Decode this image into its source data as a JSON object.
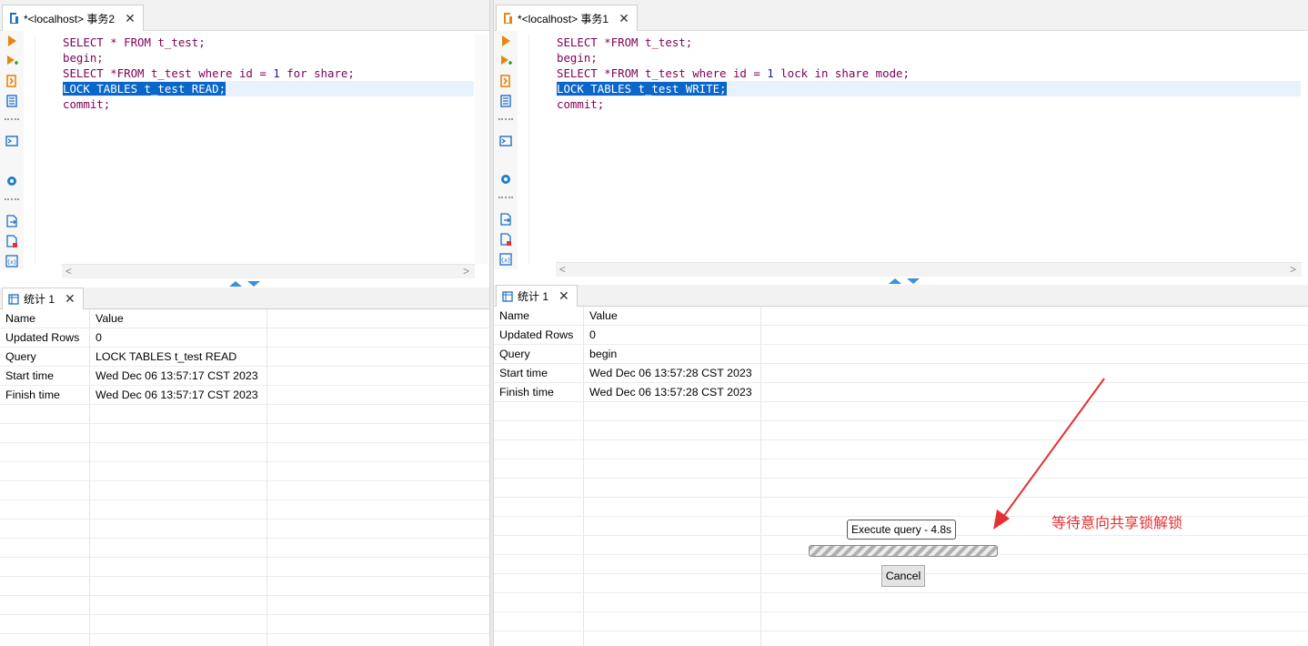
{
  "left": {
    "tab_title": "*<localhost> 事务2",
    "close_glyph": "✕",
    "code": [
      [
        {
          "t": "SELECT * FROM t_test",
          "c": "kw"
        },
        {
          "t": ";",
          "c": "kw"
        }
      ],
      [
        {
          "t": "begin;",
          "c": "kw"
        }
      ],
      [
        {
          "t": "SELECT *FROM t_test ",
          "c": "kw"
        },
        {
          "t": "where",
          "c": "kw"
        },
        {
          "t": " id = ",
          "c": "kw"
        },
        {
          "t": "1",
          "c": "num"
        },
        {
          "t": " ",
          "c": ""
        },
        {
          "t": "for",
          "c": "kw"
        },
        {
          "t": " share;",
          "c": "kw"
        }
      ],
      [
        {
          "t": "LOCK TABLES t_test READ;",
          "c": "sel"
        }
      ],
      [
        {
          "t": "commit;",
          "c": "kw"
        }
      ]
    ],
    "active_line": 3,
    "results_tab": "统计 1",
    "results_header": {
      "name": "Name",
      "value": "Value"
    },
    "results_rows": [
      {
        "name": "Updated Rows",
        "value": "0"
      },
      {
        "name": "Query",
        "value": "LOCK TABLES t_test READ"
      },
      {
        "name": "Start time",
        "value": "Wed Dec 06 13:57:17 CST 2023"
      },
      {
        "name": "Finish time",
        "value": "Wed Dec 06 13:57:17 CST 2023"
      }
    ],
    "scroll_left": "<",
    "scroll_right": ">"
  },
  "right": {
    "tab_title": "*<localhost> 事务1",
    "close_glyph": "✕",
    "code": [
      [
        {
          "t": "SELECT *FROM t_test;",
          "c": "kw"
        }
      ],
      [
        {
          "t": "begin;",
          "c": "kw"
        }
      ],
      [
        {
          "t": "SELECT *FROM t_test ",
          "c": "kw"
        },
        {
          "t": "where",
          "c": "kw"
        },
        {
          "t": " id = ",
          "c": "kw"
        },
        {
          "t": "1",
          "c": "num"
        },
        {
          "t": " ",
          "c": ""
        },
        {
          "t": "lock",
          "c": "kw"
        },
        {
          "t": " ",
          "c": ""
        },
        {
          "t": "in",
          "c": "kw"
        },
        {
          "t": " share mode;",
          "c": "kw"
        }
      ],
      [
        {
          "t": "LOCK TABLES t_test WRITE;",
          "c": "sel"
        }
      ],
      [
        {
          "t": "commit;",
          "c": "kw"
        }
      ]
    ],
    "active_line": 3,
    "results_tab": "统计 1",
    "results_header": {
      "name": "Name",
      "value": "Value"
    },
    "results_rows": [
      {
        "name": "Updated Rows",
        "value": "0"
      },
      {
        "name": "Query",
        "value": "begin"
      },
      {
        "name": "Start time",
        "value": "Wed Dec 06 13:57:28 CST 2023"
      },
      {
        "name": "Finish time",
        "value": "Wed Dec 06 13:57:28 CST 2023"
      }
    ],
    "scroll_left": "<",
    "scroll_right": ">"
  },
  "progress": {
    "label": "Execute query - 4.8s",
    "cancel_label": "Cancel"
  },
  "annotation": {
    "text": "等待意向共享锁解锁",
    "color": "#e53030"
  },
  "colors": {
    "keyword": "#7f0055",
    "number": "#1a1aa6",
    "selection": "#0a66c8",
    "icon_orange": "#e8850c",
    "icon_blue": "#1f6fc4"
  }
}
